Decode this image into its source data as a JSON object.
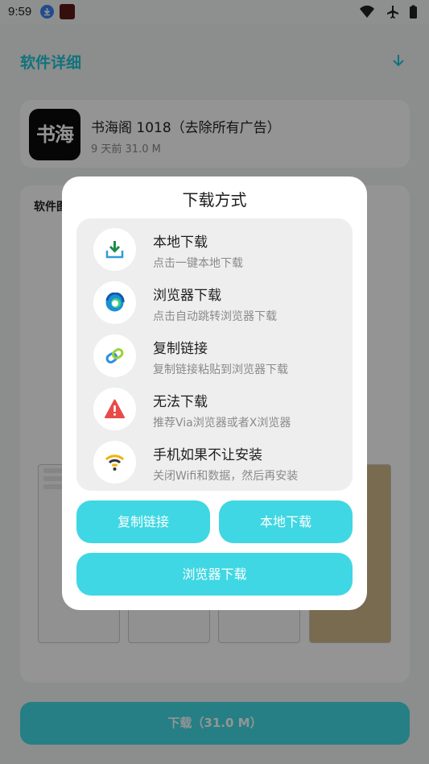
{
  "status_bar": {
    "time": "9:59"
  },
  "page": {
    "title": "软件详细",
    "app": {
      "name": "书海阁 1018（去除所有广告）",
      "meta": "9 天前    31.0 M",
      "logo_text": "书海"
    },
    "screenshots_label": "软件图",
    "download_button": "下载（31.0 M）"
  },
  "dialog": {
    "title": "下载方式",
    "options": [
      {
        "title": "本地下载",
        "subtitle": "点击一键本地下载",
        "icon": "download-tray-icon"
      },
      {
        "title": "浏览器下载",
        "subtitle": "点击自动跳转浏览器下载",
        "icon": "edge-browser-icon"
      },
      {
        "title": "复制链接",
        "subtitle": "复制链接粘贴到浏览器下载",
        "icon": "link-icon"
      },
      {
        "title": "无法下载",
        "subtitle": "推荐Via浏览器或者X浏览器",
        "icon": "warning-icon"
      },
      {
        "title": "手机如果不让安装",
        "subtitle": "关闭Wifi和数据，然后再安装",
        "icon": "wifi-icon"
      }
    ],
    "buttons": {
      "copy_link": "复制链接",
      "local_download": "本地下载",
      "browser_download": "浏览器下载"
    }
  },
  "colors": {
    "accent": "#3fd7e3",
    "title_accent": "#1fc6d6",
    "warning": "#e84a4a",
    "download_green": "#1f8a4c"
  }
}
